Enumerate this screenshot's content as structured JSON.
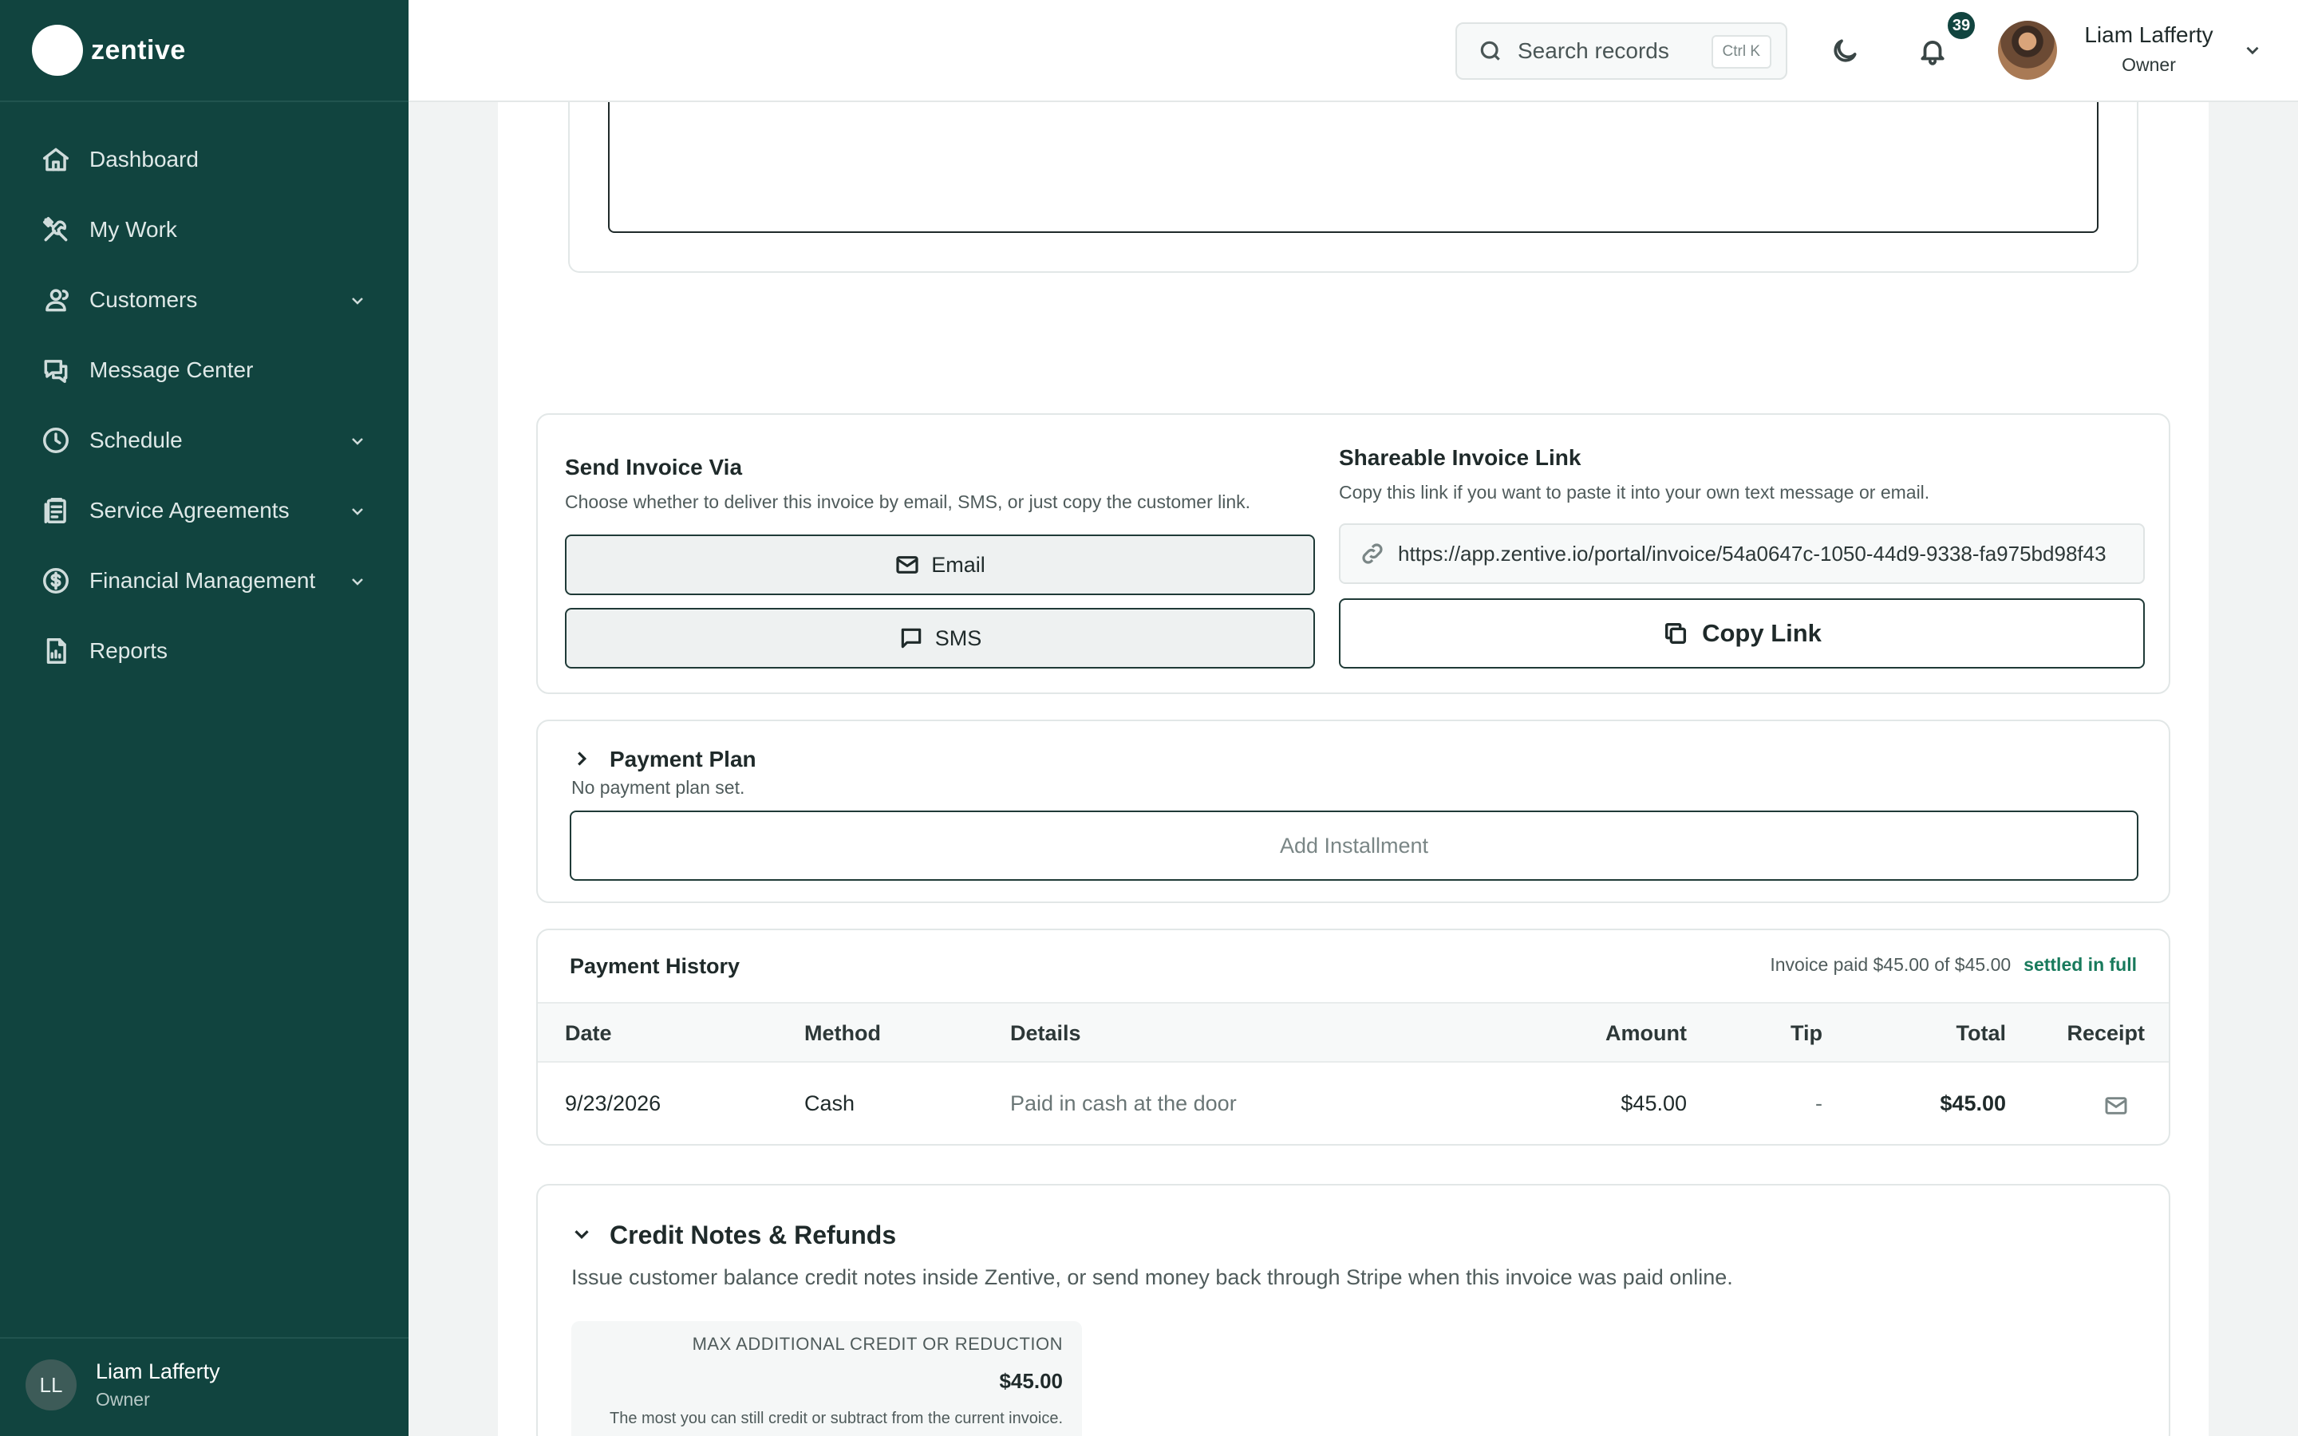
{
  "app": {
    "logo_text": "zentive"
  },
  "sidebar": {
    "items": [
      {
        "label": "Dashboard",
        "icon": "home-icon",
        "has_chevron": false
      },
      {
        "label": "My Work",
        "icon": "tools-icon",
        "has_chevron": false
      },
      {
        "label": "Customers",
        "icon": "users-icon",
        "has_chevron": true
      },
      {
        "label": "Message Center",
        "icon": "chat-icon",
        "has_chevron": false
      },
      {
        "label": "Schedule",
        "icon": "clock-icon",
        "has_chevron": true
      },
      {
        "label": "Service Agreements",
        "icon": "clipboard-icon",
        "has_chevron": true
      },
      {
        "label": "Financial Management",
        "icon": "dollar-icon",
        "has_chevron": true
      },
      {
        "label": "Reports",
        "icon": "report-icon",
        "has_chevron": false
      }
    ],
    "user": {
      "initials": "LL",
      "name": "Liam Lafferty",
      "role": "Owner"
    }
  },
  "header": {
    "search": {
      "placeholder": "Search records",
      "shortcut": "Ctrl K"
    },
    "notifications": {
      "count": "39"
    },
    "user": {
      "name": "Liam Lafferty",
      "role": "Owner"
    }
  },
  "send_invoice": {
    "title": "Send Invoice Via",
    "description": "Choose whether to deliver this invoice by email, SMS, or just copy the customer link.",
    "email_label": "Email",
    "sms_label": "SMS"
  },
  "share_link": {
    "title": "Shareable Invoice Link",
    "description": "Copy this link if you want to paste it into your own text message or email.",
    "url": "https://app.zentive.io/portal/invoice/54a0647c-1050-44d9-9338-fa975bd98f43",
    "copy_label": "Copy Link"
  },
  "payment_plan": {
    "title": "Payment Plan",
    "subtitle": "No payment plan set.",
    "add_label": "Add Installment"
  },
  "payment_history": {
    "title": "Payment History",
    "status_text": "Invoice paid $45.00 of $45.00",
    "status_badge": "settled in full",
    "columns": [
      "Date",
      "Method",
      "Details",
      "Amount",
      "Tip",
      "Total",
      "Receipt"
    ],
    "rows": [
      {
        "date": "9/23/2026",
        "method": "Cash",
        "details": "Paid in cash at the door",
        "amount": "$45.00",
        "tip": "-",
        "total": "$45.00",
        "receipt_icon": "mail-icon"
      }
    ]
  },
  "credit_notes": {
    "title": "Credit Notes & Refunds",
    "description": "Issue customer balance credit notes inside Zentive, or send money back through Stripe when this invoice was paid online.",
    "max_label": "MAX ADDITIONAL CREDIT OR REDUCTION",
    "max_value": "$45.00",
    "max_note": "The most you can still credit or subtract from the current invoice."
  },
  "colors": {
    "sidebar": "#11443f",
    "accent_success": "#187a5c"
  }
}
